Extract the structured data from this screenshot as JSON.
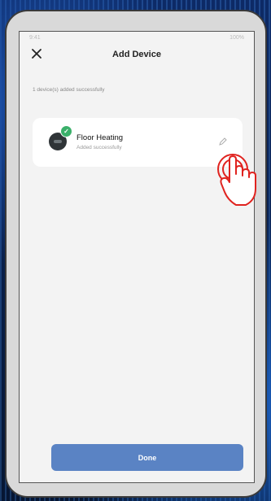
{
  "status_bar": {
    "left": "9:41",
    "right": "100%"
  },
  "header": {
    "title": "Add Device",
    "close_icon": "close-icon"
  },
  "summary": "1 device(s) added successfully",
  "device": {
    "name": "Floor Heating",
    "status": "Added successfully",
    "icon": "thermostat-icon",
    "badge_icon": "check-icon",
    "edit_icon": "pencil-icon"
  },
  "footer": {
    "done_label": "Done"
  },
  "colors": {
    "done_button": "#5a83c4",
    "badge": "#3bb06a",
    "screen_bg": "#f3f3f3",
    "hand_outline": "#e0231f"
  }
}
